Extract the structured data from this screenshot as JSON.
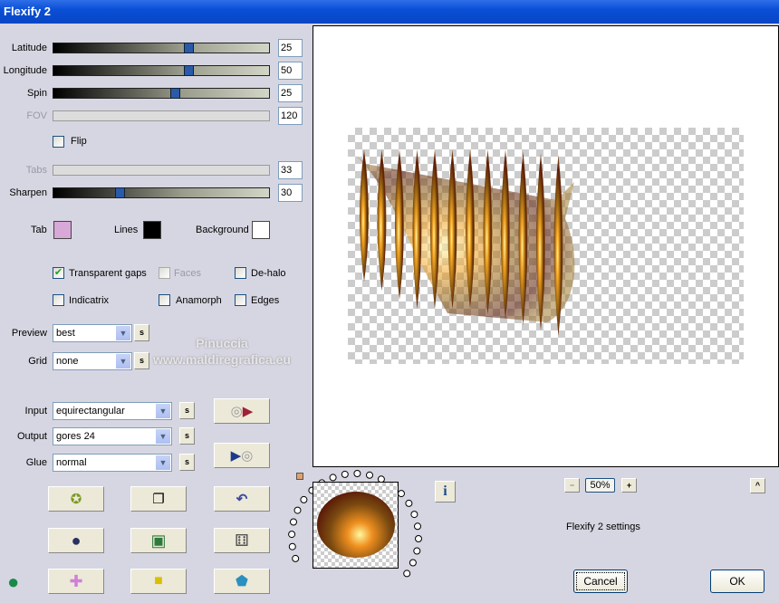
{
  "window": {
    "title": "Flexify 2"
  },
  "sliders": [
    {
      "label": "Latitude",
      "value": "25",
      "fraction": 0.63,
      "enabled": true
    },
    {
      "label": "Longitude",
      "value": "50",
      "fraction": 0.63,
      "enabled": true
    },
    {
      "label": "Spin",
      "value": "25",
      "fraction": 0.565,
      "enabled": true
    },
    {
      "label": "FOV",
      "value": "120",
      "enabled": false
    },
    {
      "label": "Tabs",
      "value": "33",
      "enabled": false
    },
    {
      "label": "Sharpen",
      "value": "30",
      "fraction": 0.3,
      "enabled": true
    }
  ],
  "flip": {
    "label": "Flip",
    "checked": false
  },
  "colors": {
    "tab_label": "Tab",
    "tab": "#d8a8d8",
    "lines_label": "Lines",
    "lines": "#000000",
    "background_label": "Background",
    "background": "#ffffff"
  },
  "options": {
    "transparent_gaps": "Transparent gaps",
    "faces": "Faces",
    "dehalo": "De-halo",
    "indicatrix": "Indicatrix",
    "anamorph": "Anamorph",
    "edges": "Edges"
  },
  "preview_sel": {
    "label": "Preview",
    "value": "best"
  },
  "grid_sel": {
    "label": "Grid",
    "value": "none"
  },
  "input_sel": {
    "label": "Input",
    "value": "equirectangular"
  },
  "output_sel": {
    "label": "Output",
    "value": "gores 24"
  },
  "glue_sel": {
    "label": "Glue",
    "value": "normal"
  },
  "s_label": "s",
  "zoom": {
    "value": "50%",
    "minus": "−",
    "plus": "+"
  },
  "caret": "^",
  "info": "i",
  "status": "Flexify 2 settings",
  "cancel": "Cancel",
  "ok": "OK",
  "watermark": "Pinuccia www.maldiregrafica.eu"
}
